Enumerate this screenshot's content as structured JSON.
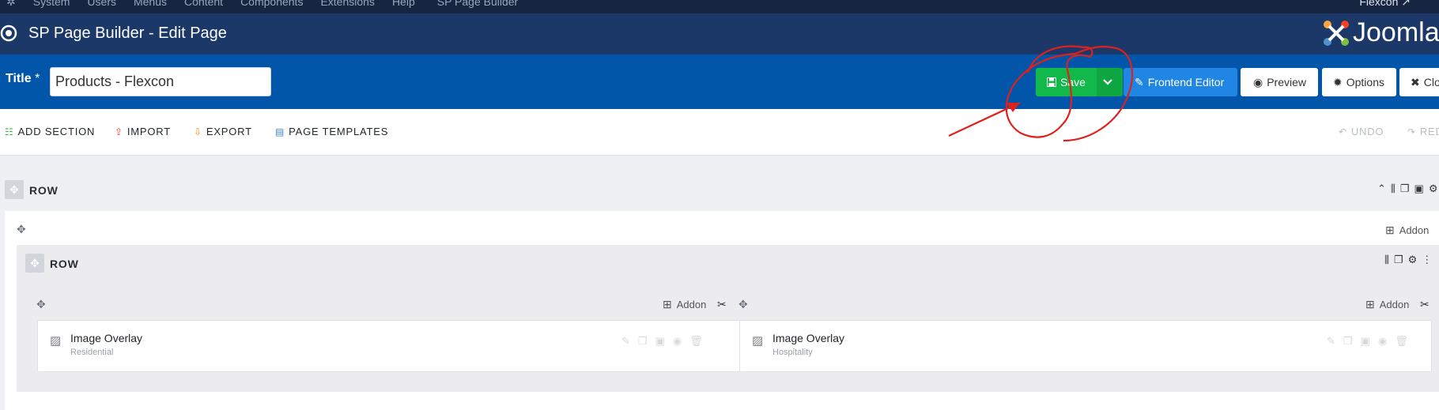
{
  "topbar": {
    "menu": [
      "System",
      "Users",
      "Menus",
      "Content",
      "Components",
      "Extensions",
      "Help",
      "SP Page Builder"
    ],
    "site_link": "Flexcon"
  },
  "titlebar": {
    "heading": "SP Page Builder - Edit Page",
    "brand": "Joomla"
  },
  "toolbar": {
    "title_label": "Title",
    "required_mark": "*",
    "title_value": "Products - Flexcon",
    "save": "Save",
    "frontend_editor": "Frontend Editor",
    "preview": "Preview",
    "options": "Options",
    "close": "Close"
  },
  "actions": {
    "add_section": "ADD SECTION",
    "import": "IMPORT",
    "export": "EXPORT",
    "page_templates": "PAGE TEMPLATES",
    "undo": "UNDO",
    "redo": "REDO"
  },
  "builder": {
    "outer_row_label": "ROW",
    "inner_row_label": "ROW",
    "addon_label": "Addon",
    "columns": [
      {
        "addon_title": "Image Overlay",
        "addon_subtitle": "Residential"
      },
      {
        "addon_title": "Image Overlay",
        "addon_subtitle": "Hospitality"
      }
    ]
  },
  "colors": {
    "topbar": "#152542",
    "titlebar": "#1b3868",
    "toolbar": "#0256aa",
    "save": "#13b84a",
    "frontend": "#1f86e3",
    "annotation": "#e0201c"
  }
}
